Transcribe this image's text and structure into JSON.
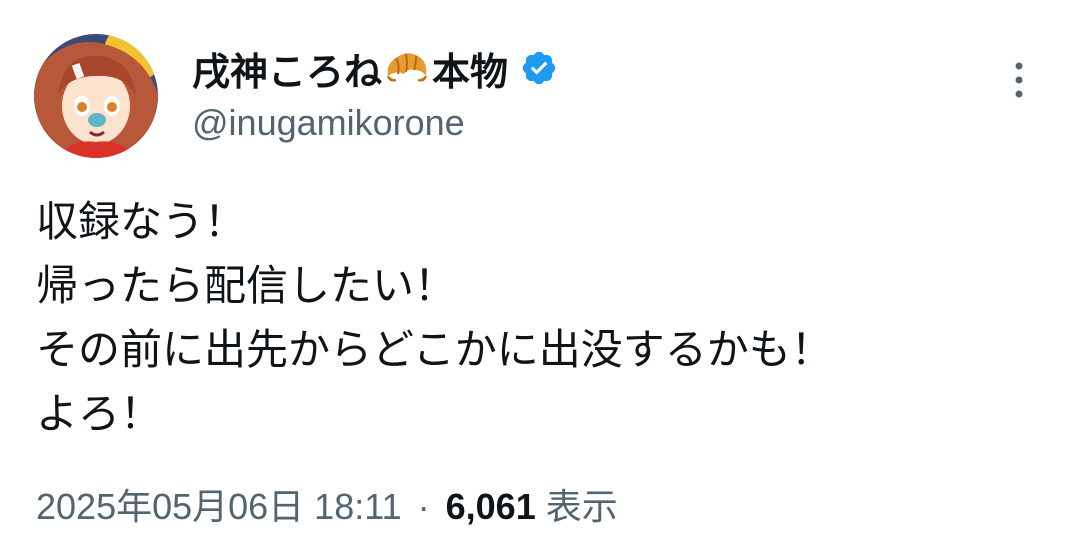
{
  "author": {
    "display_name": "戌神ころね",
    "name_emoji": "croissant-icon",
    "name_suffix": "本物",
    "handle": "@inugamikorone",
    "verified": true
  },
  "tweet": {
    "lines": [
      "収録なう！",
      "帰ったら配信したい！",
      "その前に出先からどこかに出没するかも！",
      "よろ！"
    ],
    "date_time": "2025年05月06日 18:11",
    "separator": "·",
    "views_count": "6,061",
    "views_label": "表示"
  },
  "colors": {
    "text_primary": "#0f1419",
    "text_secondary": "#536471",
    "verified_blue": "#1d9bf0"
  }
}
